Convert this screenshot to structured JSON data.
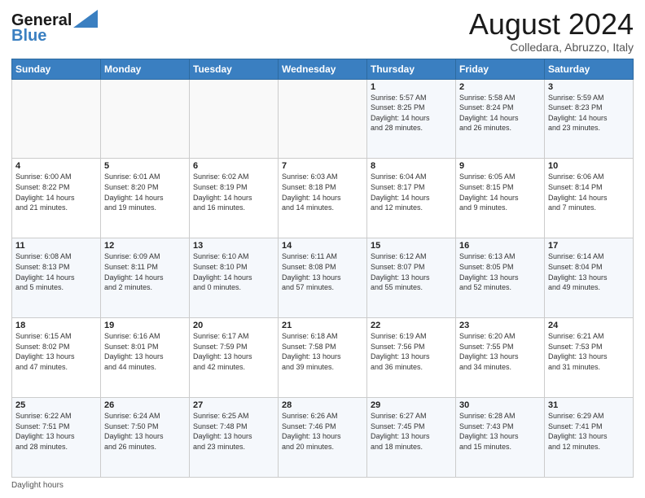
{
  "logo": {
    "line1": "General",
    "line2": "Blue"
  },
  "title": "August 2024",
  "subtitle": "Colledara, Abruzzo, Italy",
  "weekdays": [
    "Sunday",
    "Monday",
    "Tuesday",
    "Wednesday",
    "Thursday",
    "Friday",
    "Saturday"
  ],
  "weeks": [
    [
      {
        "day": "",
        "info": ""
      },
      {
        "day": "",
        "info": ""
      },
      {
        "day": "",
        "info": ""
      },
      {
        "day": "",
        "info": ""
      },
      {
        "day": "1",
        "info": "Sunrise: 5:57 AM\nSunset: 8:25 PM\nDaylight: 14 hours\nand 28 minutes."
      },
      {
        "day": "2",
        "info": "Sunrise: 5:58 AM\nSunset: 8:24 PM\nDaylight: 14 hours\nand 26 minutes."
      },
      {
        "day": "3",
        "info": "Sunrise: 5:59 AM\nSunset: 8:23 PM\nDaylight: 14 hours\nand 23 minutes."
      }
    ],
    [
      {
        "day": "4",
        "info": "Sunrise: 6:00 AM\nSunset: 8:22 PM\nDaylight: 14 hours\nand 21 minutes."
      },
      {
        "day": "5",
        "info": "Sunrise: 6:01 AM\nSunset: 8:20 PM\nDaylight: 14 hours\nand 19 minutes."
      },
      {
        "day": "6",
        "info": "Sunrise: 6:02 AM\nSunset: 8:19 PM\nDaylight: 14 hours\nand 16 minutes."
      },
      {
        "day": "7",
        "info": "Sunrise: 6:03 AM\nSunset: 8:18 PM\nDaylight: 14 hours\nand 14 minutes."
      },
      {
        "day": "8",
        "info": "Sunrise: 6:04 AM\nSunset: 8:17 PM\nDaylight: 14 hours\nand 12 minutes."
      },
      {
        "day": "9",
        "info": "Sunrise: 6:05 AM\nSunset: 8:15 PM\nDaylight: 14 hours\nand 9 minutes."
      },
      {
        "day": "10",
        "info": "Sunrise: 6:06 AM\nSunset: 8:14 PM\nDaylight: 14 hours\nand 7 minutes."
      }
    ],
    [
      {
        "day": "11",
        "info": "Sunrise: 6:08 AM\nSunset: 8:13 PM\nDaylight: 14 hours\nand 5 minutes."
      },
      {
        "day": "12",
        "info": "Sunrise: 6:09 AM\nSunset: 8:11 PM\nDaylight: 14 hours\nand 2 minutes."
      },
      {
        "day": "13",
        "info": "Sunrise: 6:10 AM\nSunset: 8:10 PM\nDaylight: 14 hours\nand 0 minutes."
      },
      {
        "day": "14",
        "info": "Sunrise: 6:11 AM\nSunset: 8:08 PM\nDaylight: 13 hours\nand 57 minutes."
      },
      {
        "day": "15",
        "info": "Sunrise: 6:12 AM\nSunset: 8:07 PM\nDaylight: 13 hours\nand 55 minutes."
      },
      {
        "day": "16",
        "info": "Sunrise: 6:13 AM\nSunset: 8:05 PM\nDaylight: 13 hours\nand 52 minutes."
      },
      {
        "day": "17",
        "info": "Sunrise: 6:14 AM\nSunset: 8:04 PM\nDaylight: 13 hours\nand 49 minutes."
      }
    ],
    [
      {
        "day": "18",
        "info": "Sunrise: 6:15 AM\nSunset: 8:02 PM\nDaylight: 13 hours\nand 47 minutes."
      },
      {
        "day": "19",
        "info": "Sunrise: 6:16 AM\nSunset: 8:01 PM\nDaylight: 13 hours\nand 44 minutes."
      },
      {
        "day": "20",
        "info": "Sunrise: 6:17 AM\nSunset: 7:59 PM\nDaylight: 13 hours\nand 42 minutes."
      },
      {
        "day": "21",
        "info": "Sunrise: 6:18 AM\nSunset: 7:58 PM\nDaylight: 13 hours\nand 39 minutes."
      },
      {
        "day": "22",
        "info": "Sunrise: 6:19 AM\nSunset: 7:56 PM\nDaylight: 13 hours\nand 36 minutes."
      },
      {
        "day": "23",
        "info": "Sunrise: 6:20 AM\nSunset: 7:55 PM\nDaylight: 13 hours\nand 34 minutes."
      },
      {
        "day": "24",
        "info": "Sunrise: 6:21 AM\nSunset: 7:53 PM\nDaylight: 13 hours\nand 31 minutes."
      }
    ],
    [
      {
        "day": "25",
        "info": "Sunrise: 6:22 AM\nSunset: 7:51 PM\nDaylight: 13 hours\nand 28 minutes."
      },
      {
        "day": "26",
        "info": "Sunrise: 6:24 AM\nSunset: 7:50 PM\nDaylight: 13 hours\nand 26 minutes."
      },
      {
        "day": "27",
        "info": "Sunrise: 6:25 AM\nSunset: 7:48 PM\nDaylight: 13 hours\nand 23 minutes."
      },
      {
        "day": "28",
        "info": "Sunrise: 6:26 AM\nSunset: 7:46 PM\nDaylight: 13 hours\nand 20 minutes."
      },
      {
        "day": "29",
        "info": "Sunrise: 6:27 AM\nSunset: 7:45 PM\nDaylight: 13 hours\nand 18 minutes."
      },
      {
        "day": "30",
        "info": "Sunrise: 6:28 AM\nSunset: 7:43 PM\nDaylight: 13 hours\nand 15 minutes."
      },
      {
        "day": "31",
        "info": "Sunrise: 6:29 AM\nSunset: 7:41 PM\nDaylight: 13 hours\nand 12 minutes."
      }
    ]
  ],
  "footer": "Daylight hours"
}
